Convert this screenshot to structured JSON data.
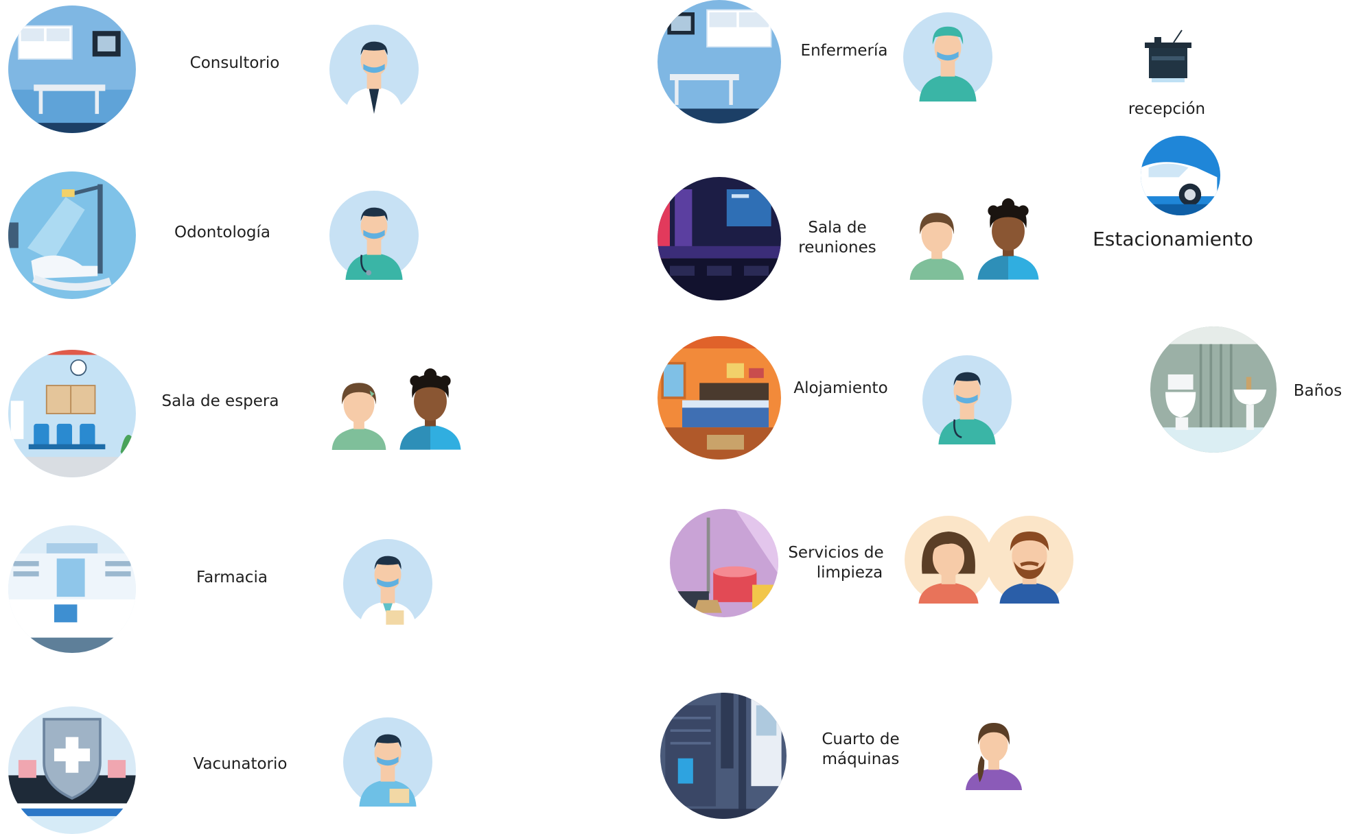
{
  "left_column": [
    {
      "room": "Consultorio"
    },
    {
      "room": "Odontología"
    },
    {
      "room": "Sala de espera"
    },
    {
      "room": "Farmacia"
    },
    {
      "room": "Vacunatorio"
    }
  ],
  "right_column": [
    {
      "room": "Enfermería"
    },
    {
      "room_line1": "Sala de",
      "room_line2": "reuniones"
    },
    {
      "room": "Alojamiento"
    },
    {
      "room_line1": "Servicios de",
      "room_line2": "limpieza"
    },
    {
      "room_line1": "Cuarto de",
      "room_line2": "máquinas"
    }
  ],
  "far_right": {
    "reception": "recepción",
    "parking": "Estacionamiento",
    "bathrooms": "Baños"
  },
  "colors": {
    "sky_blue": "#7fb7e3",
    "avatar_bg": "#c7e1f4",
    "teal_scrubs": "#3ab5a6",
    "dark_navy": "#1d3247",
    "skin": "#f6cba8"
  }
}
